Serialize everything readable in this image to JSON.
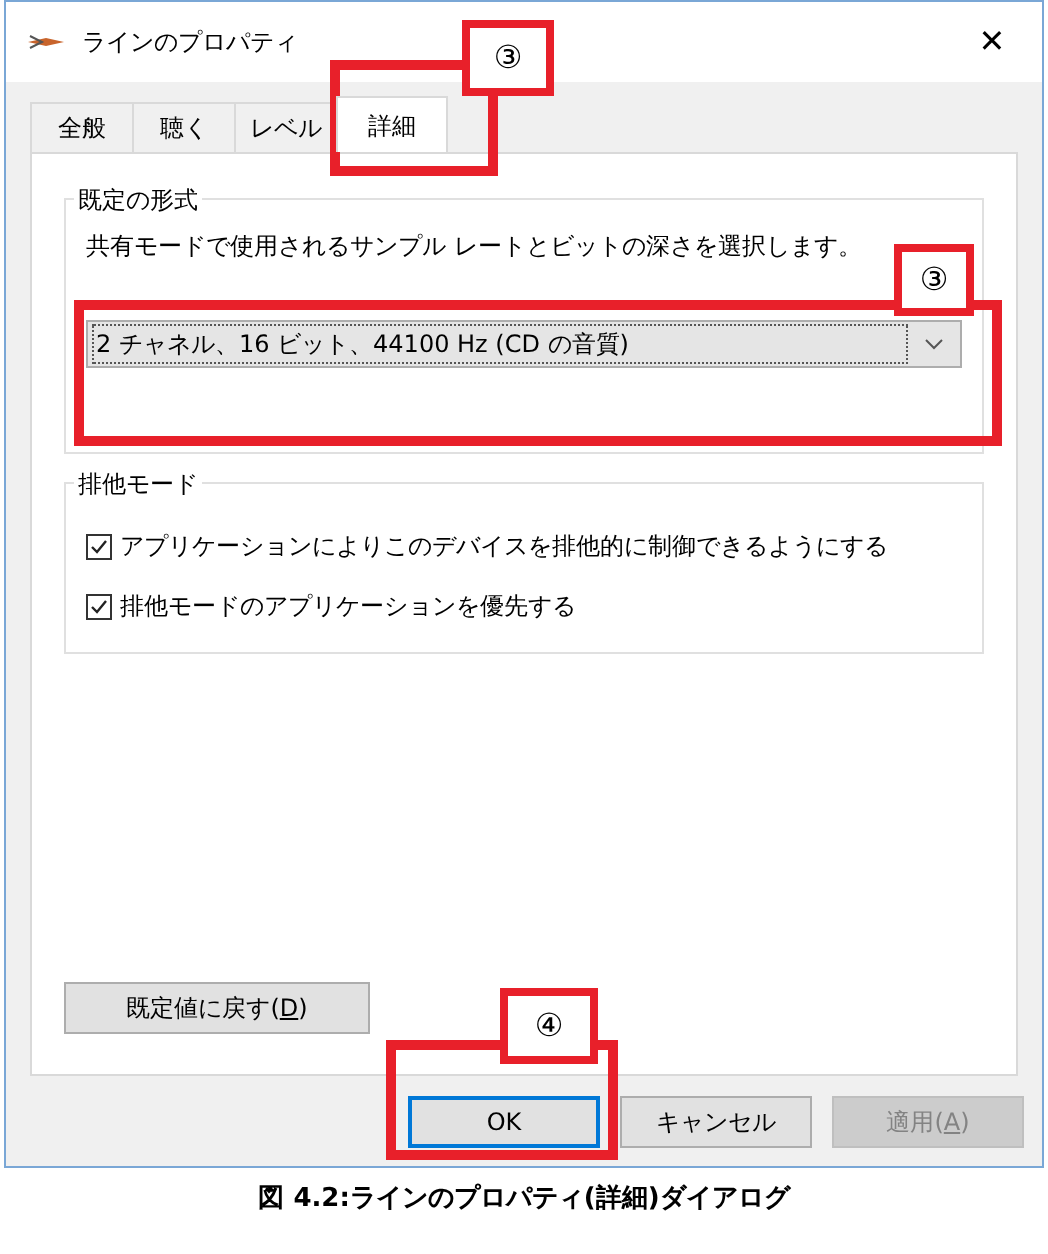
{
  "window": {
    "title": "ラインのプロパティ",
    "close": "✕"
  },
  "tabs": [
    {
      "label": "全般",
      "selected": false
    },
    {
      "label": "聴く",
      "selected": false
    },
    {
      "label": "レベル",
      "selected": false
    },
    {
      "label": "詳細",
      "selected": true
    }
  ],
  "default_format": {
    "title": "既定の形式",
    "description": "共有モードで使用されるサンプル レートとビットの深さを選択します。",
    "value": "2 チャネル、16 ビット、44100 Hz (CD の音質)"
  },
  "exclusive_mode": {
    "title": "排他モード",
    "options": [
      {
        "label": "アプリケーションによりこのデバイスを排他的に制御できるようにする",
        "checked": true
      },
      {
        "label": "排他モードのアプリケーションを優先する",
        "checked": true
      }
    ]
  },
  "restore_button": {
    "label_before": "既定値に戻す(",
    "access_key": "D",
    "label_after": ")"
  },
  "buttons": [
    {
      "label_before": "OK",
      "default": true,
      "disabled": false
    },
    {
      "label_before": "キャンセル",
      "default": false,
      "disabled": false
    },
    {
      "label_before": "適用(",
      "access_key": "A",
      "label_after": ")",
      "default": false,
      "disabled": true
    }
  ],
  "annotations": [
    {
      "label": "③"
    },
    {
      "label": "③"
    },
    {
      "label": "④"
    }
  ],
  "caption": "図 4.2:ラインのプロパティ(詳細)ダイアログ"
}
